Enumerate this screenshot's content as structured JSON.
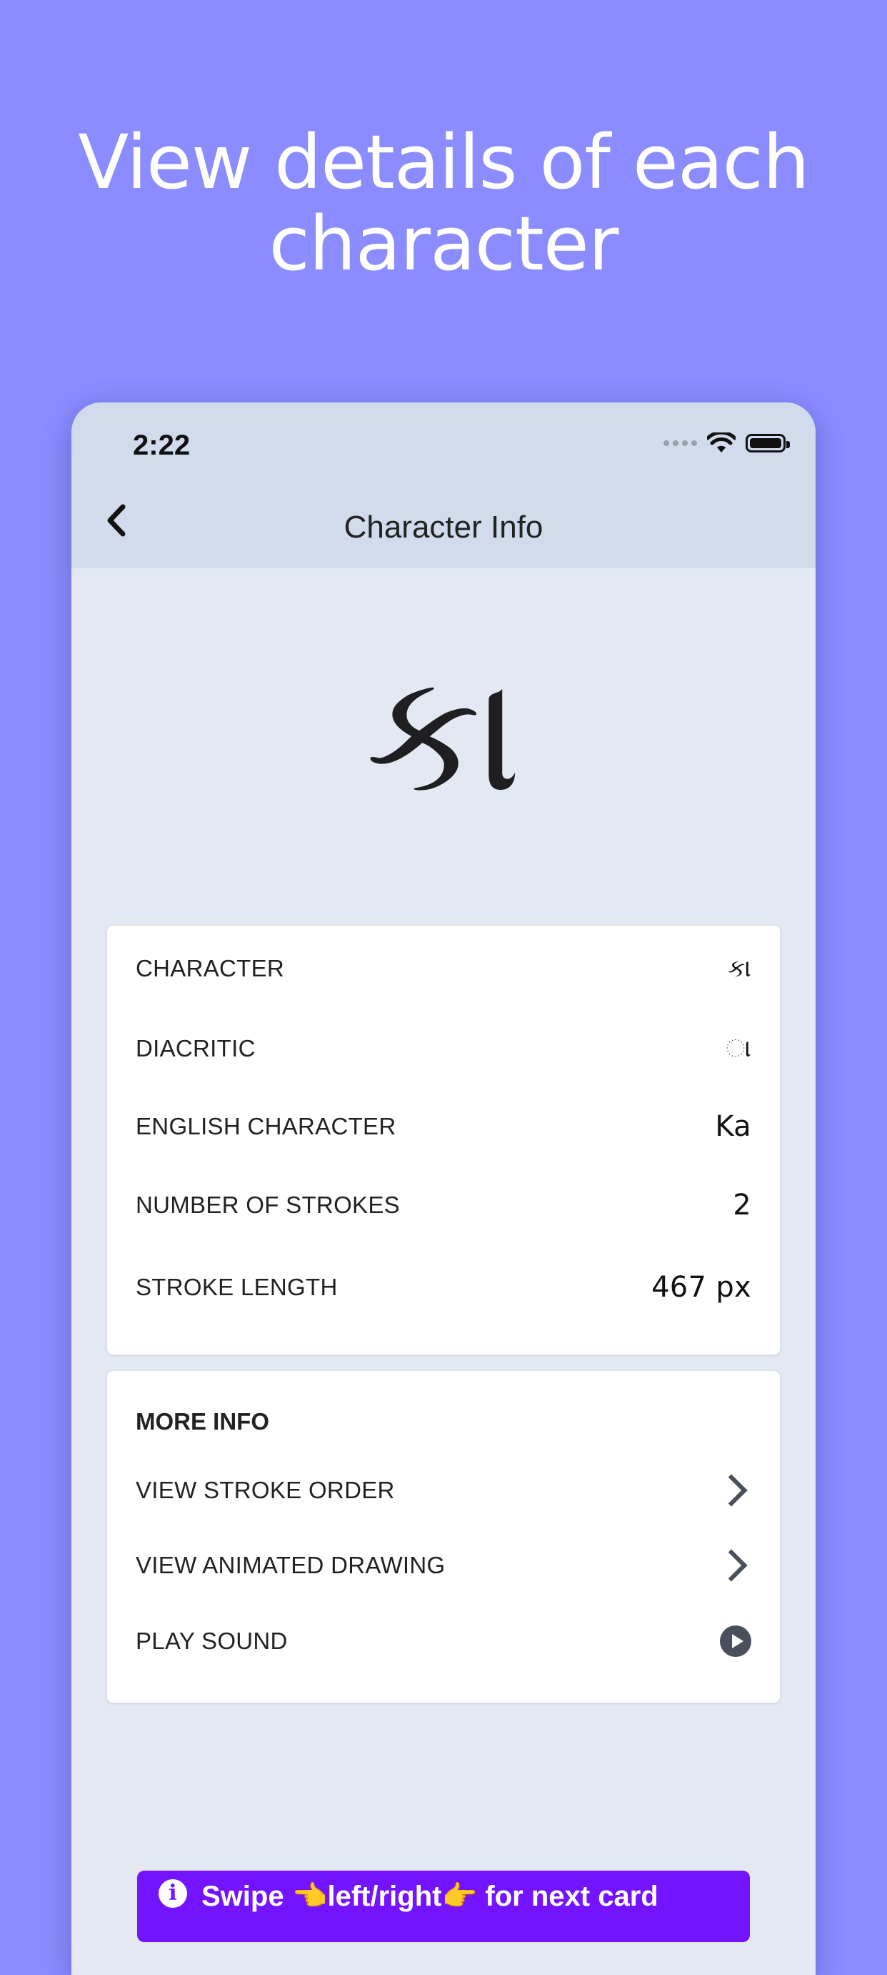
{
  "headline": {
    "line1": "View details of each",
    "line2": "character"
  },
  "status_bar": {
    "time": "2:22"
  },
  "nav": {
    "title": "Character Info"
  },
  "hero": {
    "character": "કા"
  },
  "details": [
    {
      "label": "CHARACTER",
      "value": "કા"
    },
    {
      "label": "DIACRITIC",
      "value": "◌ા"
    },
    {
      "label": "ENGLISH CHARACTER",
      "value": "Ka"
    },
    {
      "label": "NUMBER OF STROKES",
      "value": "2"
    },
    {
      "label": "STROKE LENGTH",
      "value": "467 px"
    }
  ],
  "more_info": {
    "title": "MORE INFO",
    "items": [
      {
        "label": "VIEW STROKE ORDER",
        "icon": "chevron-right-icon"
      },
      {
        "label": "VIEW ANIMATED DRAWING",
        "icon": "chevron-right-icon"
      },
      {
        "label": "PLAY SOUND",
        "icon": "play-icon"
      }
    ]
  },
  "banner": {
    "info_glyph": "i",
    "text": "Swipe 👈left/right👉 for next card"
  },
  "colors": {
    "background": "#8a8cff",
    "banner": "#7413ff",
    "topbar": "#d1dbeb",
    "screen": "#e3e8f3"
  }
}
